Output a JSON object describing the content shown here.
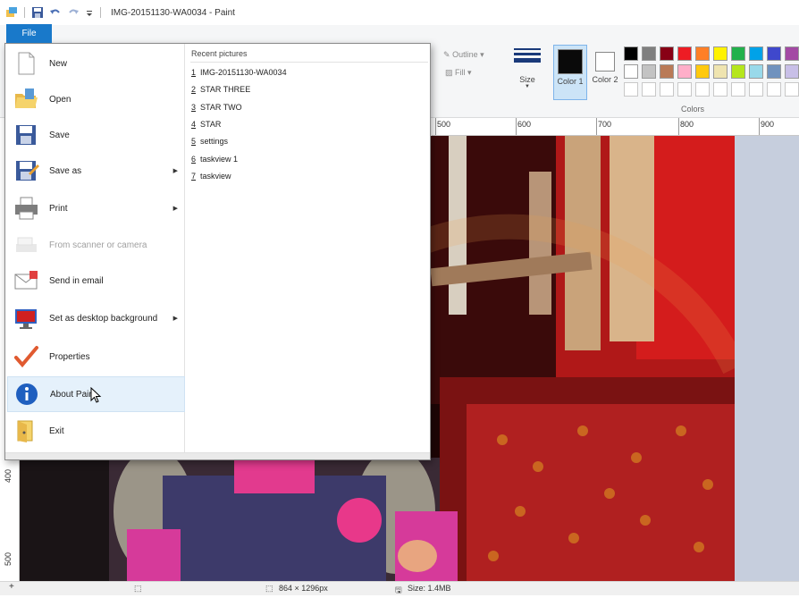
{
  "window": {
    "title": "IMG-20151130-WA0034 - Paint"
  },
  "quick_access": {
    "icons": [
      "paint-app-icon",
      "save-icon",
      "undo-icon",
      "redo-icon",
      "customize-icon"
    ]
  },
  "file_tab": {
    "label": "File"
  },
  "menu": {
    "items": [
      {
        "name": "new",
        "label": "New",
        "icon": "new-document-icon",
        "submenu": false,
        "enabled": true
      },
      {
        "name": "open",
        "label": "Open",
        "icon": "open-folder-icon",
        "submenu": false,
        "enabled": true
      },
      {
        "name": "save",
        "label": "Save",
        "icon": "save-icon",
        "submenu": false,
        "enabled": true
      },
      {
        "name": "save-as",
        "label": "Save as",
        "icon": "save-as-icon",
        "submenu": true,
        "enabled": true
      },
      {
        "name": "print",
        "label": "Print",
        "icon": "printer-icon",
        "submenu": true,
        "enabled": true
      },
      {
        "name": "from-scanner",
        "label": "From scanner or camera",
        "icon": "scanner-icon",
        "submenu": false,
        "enabled": false
      },
      {
        "name": "send-email",
        "label": "Send in email",
        "icon": "email-icon",
        "submenu": false,
        "enabled": true
      },
      {
        "name": "desktop-bg",
        "label": "Set as desktop background",
        "icon": "desktop-icon",
        "submenu": true,
        "enabled": true
      },
      {
        "name": "properties",
        "label": "Properties",
        "icon": "checkmark-icon",
        "submenu": false,
        "enabled": true
      },
      {
        "name": "about",
        "label": "About Paint",
        "icon": "info-icon",
        "submenu": false,
        "enabled": true
      },
      {
        "name": "exit",
        "label": "Exit",
        "icon": "exit-icon",
        "submenu": false,
        "enabled": true
      }
    ],
    "recent": {
      "header": "Recent pictures",
      "items": [
        {
          "num": "1",
          "label": "IMG-20151130-WA0034"
        },
        {
          "num": "2",
          "label": "STAR THREE"
        },
        {
          "num": "3",
          "label": "STAR TWO"
        },
        {
          "num": "4",
          "label": "STAR"
        },
        {
          "num": "5",
          "label": "settings"
        },
        {
          "num": "6",
          "label": "taskview 1"
        },
        {
          "num": "7",
          "label": "taskview"
        }
      ]
    }
  },
  "ribbon": {
    "outline_label": "Outline",
    "fill_label": "Fill",
    "size_label": "Size",
    "color1_label": "Color 1",
    "color2_label": "Color 2",
    "colors_label": "Colors",
    "color1_value": "#0a0a0a",
    "color2_value": "#ffffff",
    "palette_row1": [
      "#000000",
      "#7f7f7f",
      "#880015",
      "#ed1c24",
      "#ff7f27",
      "#fff200",
      "#22b14c",
      "#00a2e8",
      "#3f48cc",
      "#a349a4"
    ],
    "palette_row2": [
      "#ffffff",
      "#c3c3c3",
      "#b97a57",
      "#ffaec9",
      "#ffc90e",
      "#efe4b0",
      "#b5e61d",
      "#99d9ea",
      "#7092be",
      "#c8bfe7"
    ]
  },
  "ruler": {
    "h_ticks": [
      "500",
      "600",
      "700",
      "800",
      "900"
    ],
    "v_ticks": [
      "400",
      "500"
    ]
  },
  "status": {
    "dimensions": "864 × 1296px",
    "size": "Size: 1.4MB"
  }
}
